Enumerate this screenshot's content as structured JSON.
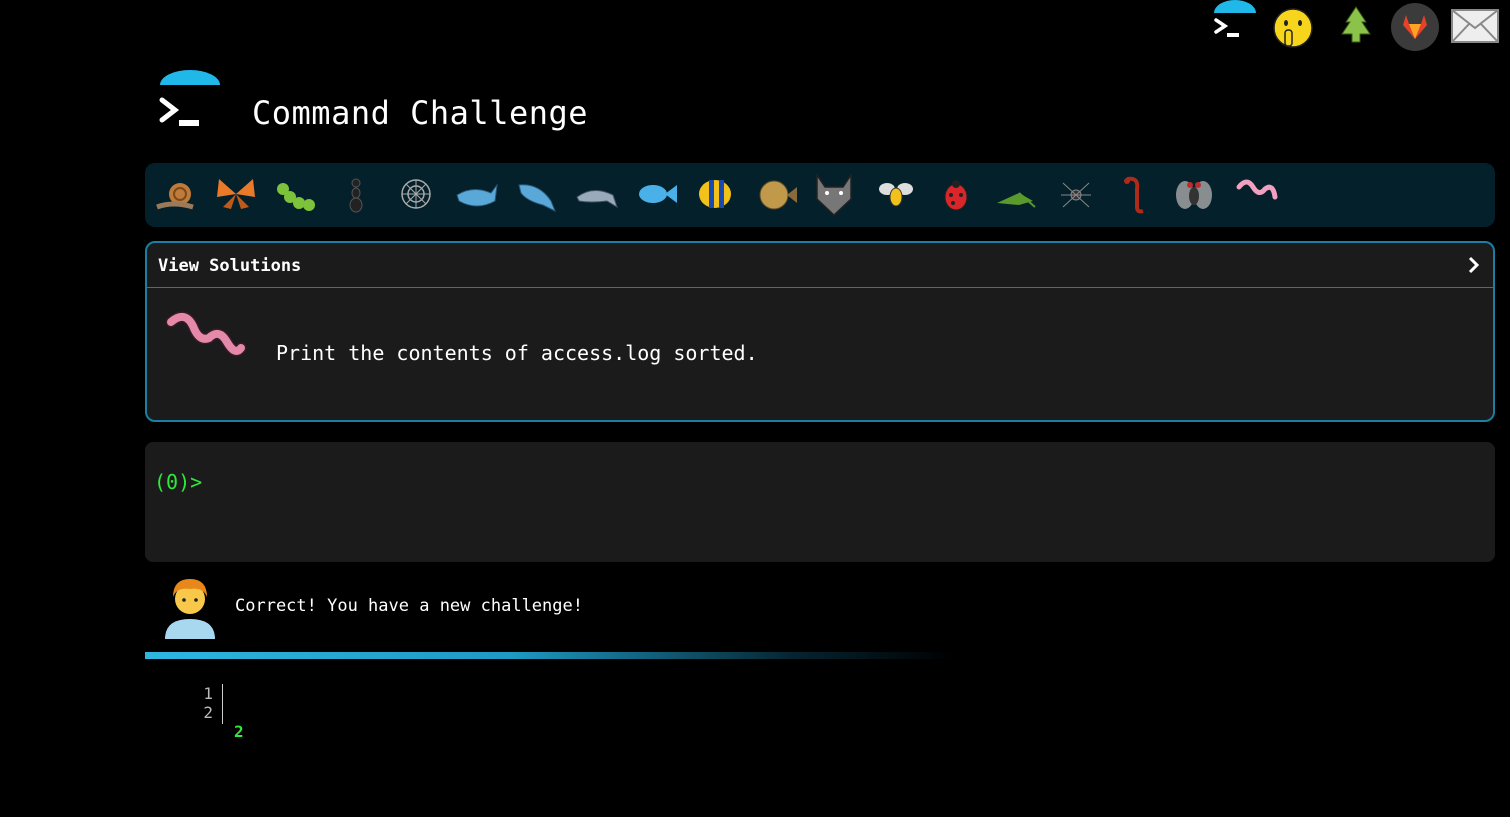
{
  "header": {
    "title": "Command Challenge",
    "logo_icon": "terminal-umbrella-icon"
  },
  "top_icons": [
    "terminal-umbrella-icon",
    "shushing-face-icon",
    "evergreen-tree-icon",
    "gitlab-icon",
    "envelope-icon"
  ],
  "animals": [
    "snail",
    "butterfly",
    "caterpillar",
    "ant",
    "spider-web",
    "whale",
    "shark",
    "dolphin",
    "fish",
    "tropical-fish",
    "blowfish",
    "wolf",
    "bee",
    "ladybug",
    "cricket",
    "spider",
    "scorpion",
    "fly",
    "worm"
  ],
  "solutions": {
    "label": "View Solutions",
    "chevron": "›",
    "challenge_icon": "worm-icon",
    "challenge_text": "Print the contents of access.log sorted."
  },
  "terminal": {
    "prompt": "(0)>",
    "input_value": ""
  },
  "feedback": {
    "avatar_icon": "person-curly-hair-icon",
    "message": "Correct! You have a new challenge!",
    "progress": 0.6
  },
  "output": {
    "line_numbers": [
      "1",
      "2"
    ],
    "lines": [
      "2",
      ""
    ]
  },
  "colors": {
    "accent_blue": "#1a7fa3",
    "prompt_green": "#2ee83a",
    "panel_bg": "#1b1b1b",
    "animal_bar_bg": "#04202b"
  }
}
